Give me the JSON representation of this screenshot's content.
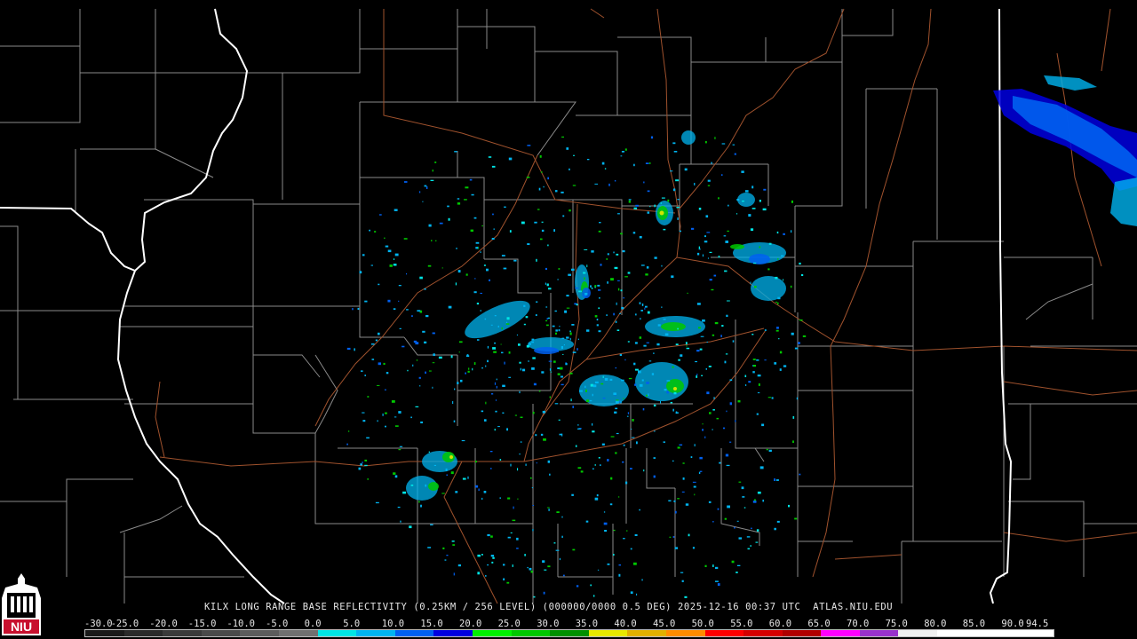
{
  "caption": {
    "product": "KILX LONG RANGE BASE REFLECTIVITY (0.25KM / 256 LEVEL) (000000/0000 0.5 DEG) 2025-12-16 00:37 UTC  ATLAS.NIU.EDU"
  },
  "logo": {
    "text": "NIU",
    "icon": "niu-castle-logo-icon",
    "color": "#c8102e"
  },
  "colors": {
    "background": "#000000",
    "county_lines": "#8a8a8a",
    "state_lines": "#ffffff",
    "highways": "#a0522d"
  },
  "scale": {
    "labels": [
      "-30.0",
      "-25.0",
      "-20.0",
      "-15.0",
      "-10.0",
      "-5.0",
      "0.0",
      "5.0",
      "10.0",
      "15.0",
      "20.0",
      "25.0",
      "30.0",
      "35.0",
      "40.0",
      "45.0",
      "50.0",
      "55.0",
      "60.0",
      "65.0",
      "70.0",
      "75.0",
      "80.0",
      "85.0",
      "90.0",
      "94.5"
    ],
    "colors": [
      "#1a1a1a",
      "#2a2a2a",
      "#3a3a3a",
      "#4a4a4a",
      "#5c5c5c",
      "#707070",
      "#00e5e5",
      "#00b4f0",
      "#0060f0",
      "#0000e0",
      "#00f000",
      "#00c800",
      "#009000",
      "#e8e800",
      "#e0b000",
      "#ff8c00",
      "#ff0000",
      "#d40000",
      "#b00000",
      "#ff00ff",
      "#9932cc",
      "#f0f0f0",
      "#ffffff",
      "#ffffff",
      "#ffffff"
    ]
  }
}
